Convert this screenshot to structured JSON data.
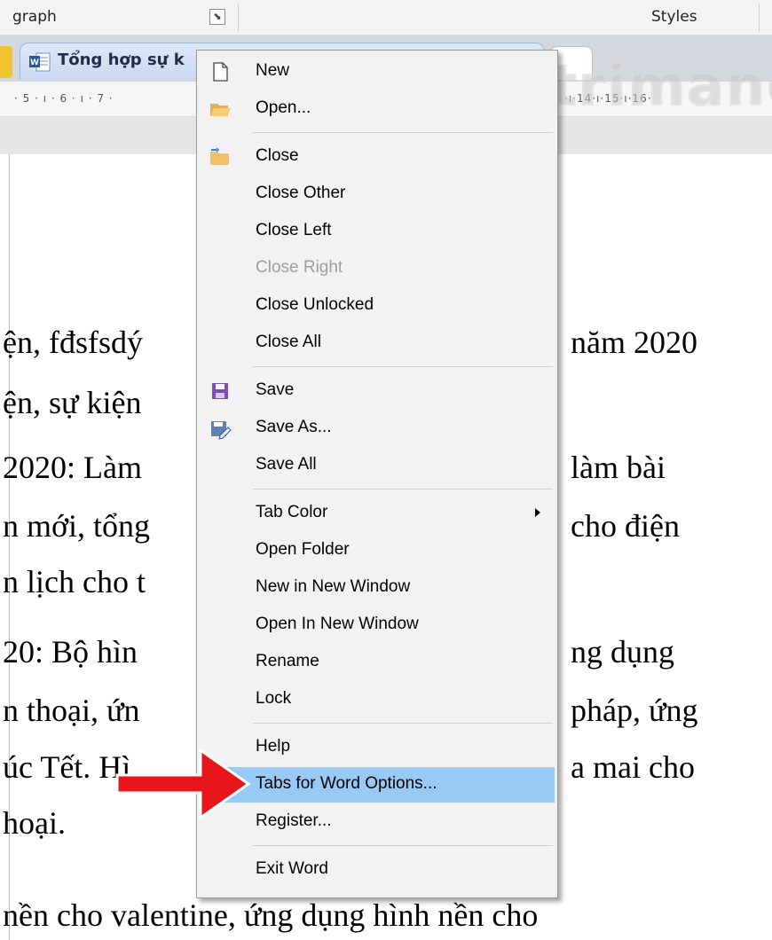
{
  "ribbon": {
    "paragraph_label": "graph",
    "styles_label": "Styles"
  },
  "tabbar": {
    "document_tab_title": "Tổng hợp sự k"
  },
  "ruler": {
    "left_ticks": "· 5 · ı · 6 · ı · 7 ·",
    "right_ticks": "·ı·14·ı·15·ı·16·"
  },
  "watermark": {
    "text": "uantrimang"
  },
  "document": {
    "lines": [
      "ện, fđsfsdý",
      "năm 2020",
      "ện, sự kiện",
      "2020: Làm",
      "làm bài",
      "n mới, tổng",
      "cho điện",
      "n lịch cho t",
      "20: Bộ hìn",
      "ng dụng",
      "n thoại, ứn",
      "pháp, ứng",
      "úc Tết.  Hì",
      "a mai cho",
      "hoại.",
      "nền cho valentine, ứng dụng hình nền cho"
    ]
  },
  "menu": {
    "items": [
      {
        "label": "New",
        "icon": "new-document-icon",
        "enabled": true
      },
      {
        "label": "Open...",
        "icon": "open-folder-icon",
        "enabled": true
      },
      {
        "label": "Close",
        "icon": "close-folder-icon",
        "enabled": true
      },
      {
        "label": "Close Other",
        "enabled": true
      },
      {
        "label": "Close Left",
        "enabled": true
      },
      {
        "label": "Close Right",
        "enabled": false
      },
      {
        "label": "Close Unlocked",
        "enabled": true
      },
      {
        "label": "Close All",
        "enabled": true
      },
      {
        "label": "Save",
        "icon": "save-icon",
        "enabled": true
      },
      {
        "label": "Save As...",
        "icon": "save-as-icon",
        "enabled": true
      },
      {
        "label": "Save All",
        "enabled": true
      },
      {
        "label": "Tab Color",
        "enabled": true,
        "submenu": true
      },
      {
        "label": "Open Folder",
        "enabled": true
      },
      {
        "label": "New in New Window",
        "enabled": true
      },
      {
        "label": "Open In New Window",
        "enabled": true
      },
      {
        "label": "Rename",
        "enabled": true
      },
      {
        "label": "Lock",
        "enabled": true
      },
      {
        "label": "Help",
        "enabled": true
      },
      {
        "label": "Tabs for Word Options...",
        "enabled": true,
        "highlighted": true
      },
      {
        "label": "Register...",
        "enabled": true
      },
      {
        "label": "Exit Word",
        "enabled": true
      }
    ]
  },
  "colors": {
    "highlight": "#99c9f5",
    "arrow": "#e8151b",
    "menu_background": "#f2f2f2",
    "save_icon": "#7b4fb0"
  }
}
